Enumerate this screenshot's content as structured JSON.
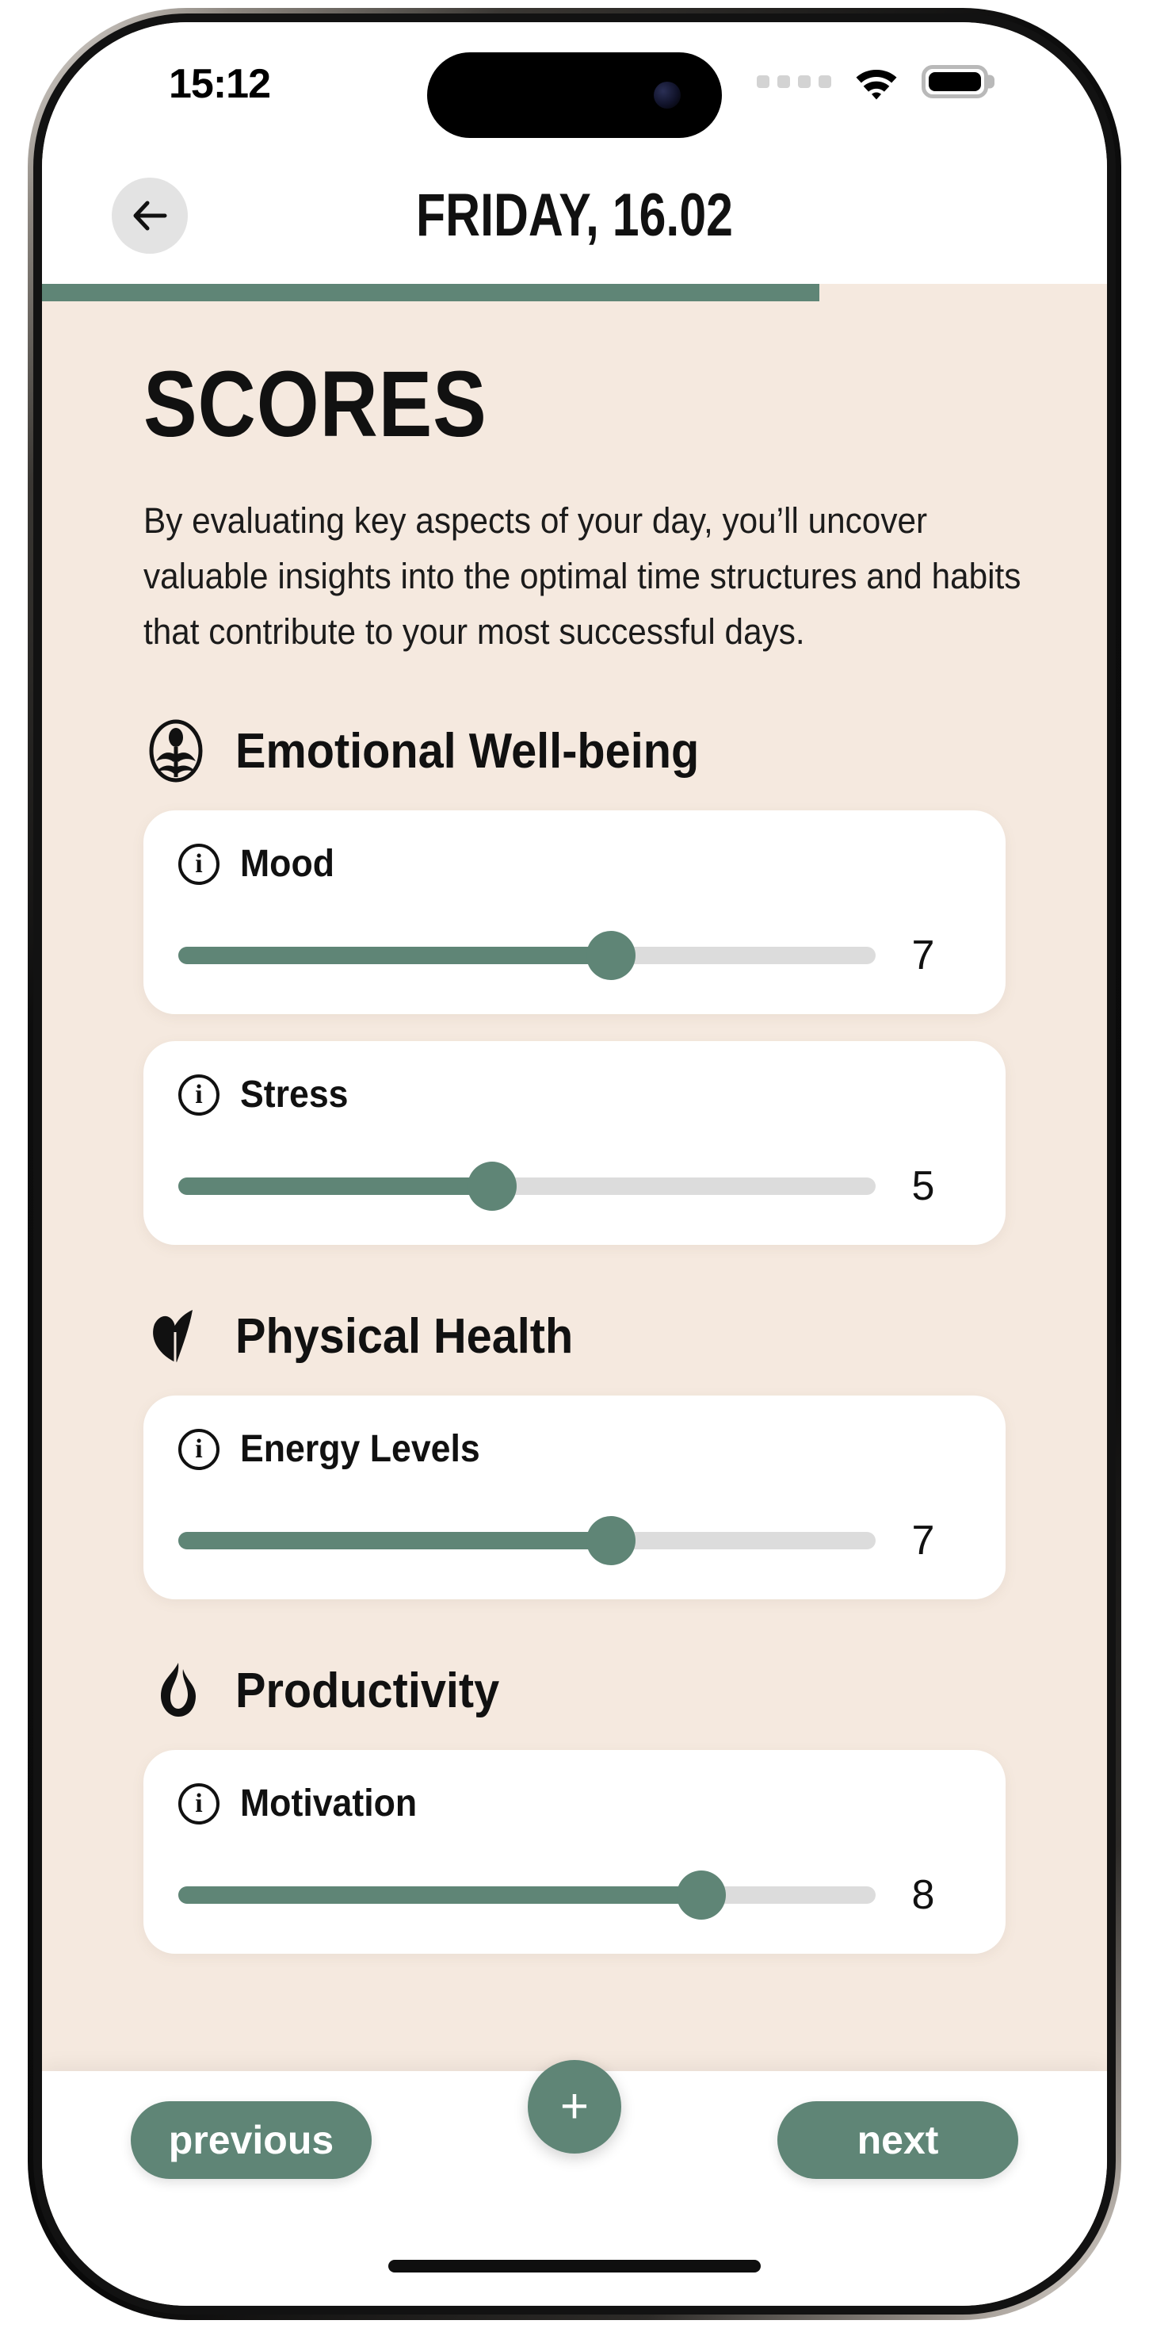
{
  "status_bar": {
    "time": "15:12",
    "signal_icon": "signal-dots-icon",
    "wifi_icon": "wifi-icon",
    "battery_icon": "battery-full-icon"
  },
  "header": {
    "back_icon": "arrow-left-icon",
    "title": "FRIDAY, 16.02",
    "progress_percent": 73
  },
  "page": {
    "title": "SCORES",
    "description": "By evaluating key aspects of your day, you’ll uncover valuable insights into the optimal time structures and habits that contribute to your most successful days."
  },
  "sections": [
    {
      "name": "Emotional Well-being",
      "icon": "head-profile-icon",
      "items": [
        {
          "label": "Mood",
          "value": "7",
          "percent": 62,
          "info_icon": "info-icon"
        },
        {
          "label": "Stress",
          "value": "5",
          "percent": 45,
          "info_icon": "info-icon"
        }
      ]
    },
    {
      "name": "Physical Health",
      "icon": "leaf-icon",
      "items": [
        {
          "label": "Energy Levels",
          "value": "7",
          "percent": 62,
          "info_icon": "info-icon"
        }
      ]
    },
    {
      "name": "Productivity",
      "icon": "flame-icon",
      "items": [
        {
          "label": "Motivation",
          "value": "8",
          "percent": 75,
          "info_icon": "info-icon"
        }
      ]
    }
  ],
  "bottom_bar": {
    "previous_label": "previous",
    "next_label": "next",
    "add_label": "+",
    "add_icon": "plus-icon"
  },
  "colors": {
    "accent_green": "#5F8576",
    "page_background": "#F5E9DF",
    "card_background": "#FFFFFF",
    "track_grey": "#DCDCDC"
  }
}
